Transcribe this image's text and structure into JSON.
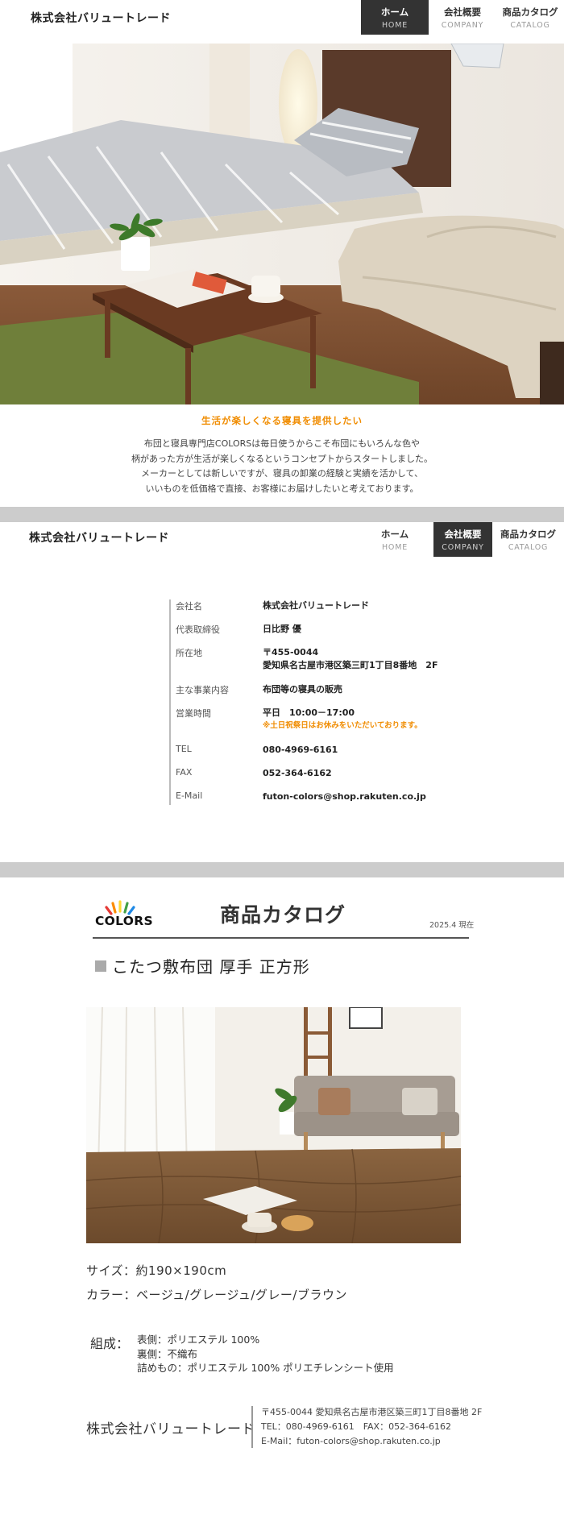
{
  "header": {
    "logo": "株式会社バリュートレード",
    "nav": [
      {
        "jp": "ホーム",
        "en": "HOME"
      },
      {
        "jp": "会社概要",
        "en": "COMPANY"
      },
      {
        "jp": "商品カタログ",
        "en": "CATALOG"
      }
    ]
  },
  "top": {
    "tagline": "生活が楽しくなる寝具を提供したい",
    "intro": [
      "布団と寝具専門店COLORSは毎日使うからこそ布団にもいろんな色や",
      "柄があった方が生活が楽しくなるというコンセプトからスタートしました。",
      "メーカーとしては新しいですが、寝具の卸業の経験と実績を活かして、",
      "いいものを低価格で直接、お客様にお届けしたいと考えております。"
    ]
  },
  "company": {
    "rows": [
      {
        "label": "会社名",
        "value": "株式会社バリュートレード"
      },
      {
        "label": "代表取締役",
        "value": "日比野 優"
      },
      {
        "label": "所在地",
        "value": "〒455-0044",
        "value2": "愛知県名古屋市港区築三町1丁目8番地　2F"
      },
      {
        "label": "主な事業内容",
        "value": "布団等の寝具の販売"
      },
      {
        "label": "営業時間",
        "value": "平日　10:00－17:00",
        "note": "※土日祝祭日はお休みをいただいております。"
      },
      {
        "label": "TEL",
        "value": "080-4969-6161"
      },
      {
        "label": "FAX",
        "value": "052-364-6162"
      },
      {
        "label": "E-Mail",
        "value": "futon-colors@shop.rakuten.co.jp"
      }
    ]
  },
  "catalog": {
    "brand": "COLORS",
    "title": "商品カタログ",
    "date": "2025.4 現在",
    "product_name": "こたつ敷布団 厚手 正方形",
    "size": "サイズ：約190×190cm",
    "color": "カラー：ベージュ/グレージュ/グレー/ブラウン",
    "composition_label": "組成：",
    "composition": [
      "表側：ポリエステル 100%",
      "裏側：不織布",
      "詰めもの：ポリエステル 100% ポリエチレンシート使用"
    ],
    "footer_company": "株式会社バリュートレード",
    "footer_contact": [
      "〒455-0044 愛知県名古屋市港区築三町1丁目8番地 2F",
      "TEL：080-4969-6161　FAX：052-364-6162",
      "E-Mail：futon-colors@shop.rakuten.co.jp"
    ]
  },
  "colors": {
    "accent": "#f08c00",
    "nav_active_bg": "#333333",
    "separator": "#cccccc"
  }
}
